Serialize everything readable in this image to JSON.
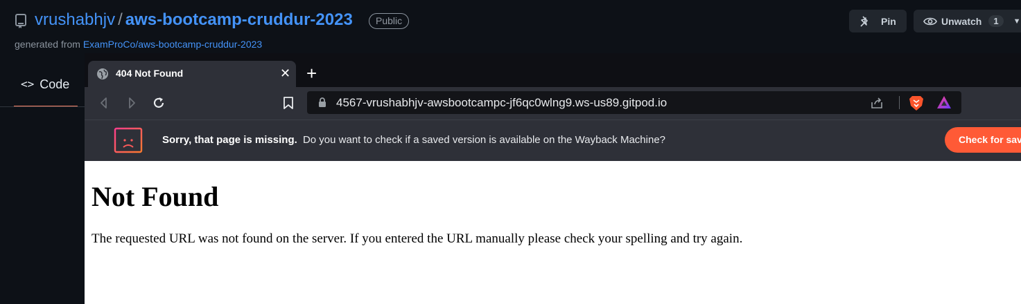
{
  "github": {
    "owner": "vrushabhjv",
    "separator": "/",
    "repo": "aws-bootcamp-cruddur-2023",
    "visibility": "Public",
    "generated_prefix": "generated from",
    "generated_source": "ExamProCo/aws-bootcamp-cruddur-2023",
    "pin_label": "Pin",
    "unwatch_label": "Unwatch",
    "watch_count": "1",
    "code_tab_label": "Code",
    "icons": [
      "repo-icon",
      "pin-icon",
      "eye-icon",
      "code-icon",
      "caret-down-icon"
    ],
    "colors": {
      "link": "#4493f8",
      "background": "#0d1117",
      "tab_underline": "#f78166"
    }
  },
  "browser": {
    "tab_title": "404 Not Found",
    "tab_close": "✕",
    "new_tab": "+",
    "url": "4567-vrushabhjv-awsbootcampc-jf6qc0wlng9.ws-us89.gitpod.io",
    "icons": [
      "globe-icon",
      "back-icon",
      "forward-icon",
      "reload-icon",
      "bookmark-icon",
      "lock-icon",
      "share-icon",
      "brave-shield-icon",
      "brave-rewards-icon",
      "sad-page-icon"
    ],
    "infobar": {
      "bold": "Sorry, that page is missing.",
      "message": "Do you want to check if a saved version is available on the Wayback Machine?",
      "button": "Check for saved version"
    },
    "colors": {
      "accent": "#ff5a36",
      "chrome": "#2e3038"
    }
  },
  "page": {
    "heading": "Not Found",
    "body": "The requested URL was not found on the server. If you entered the URL manually please check your spelling and try again."
  }
}
